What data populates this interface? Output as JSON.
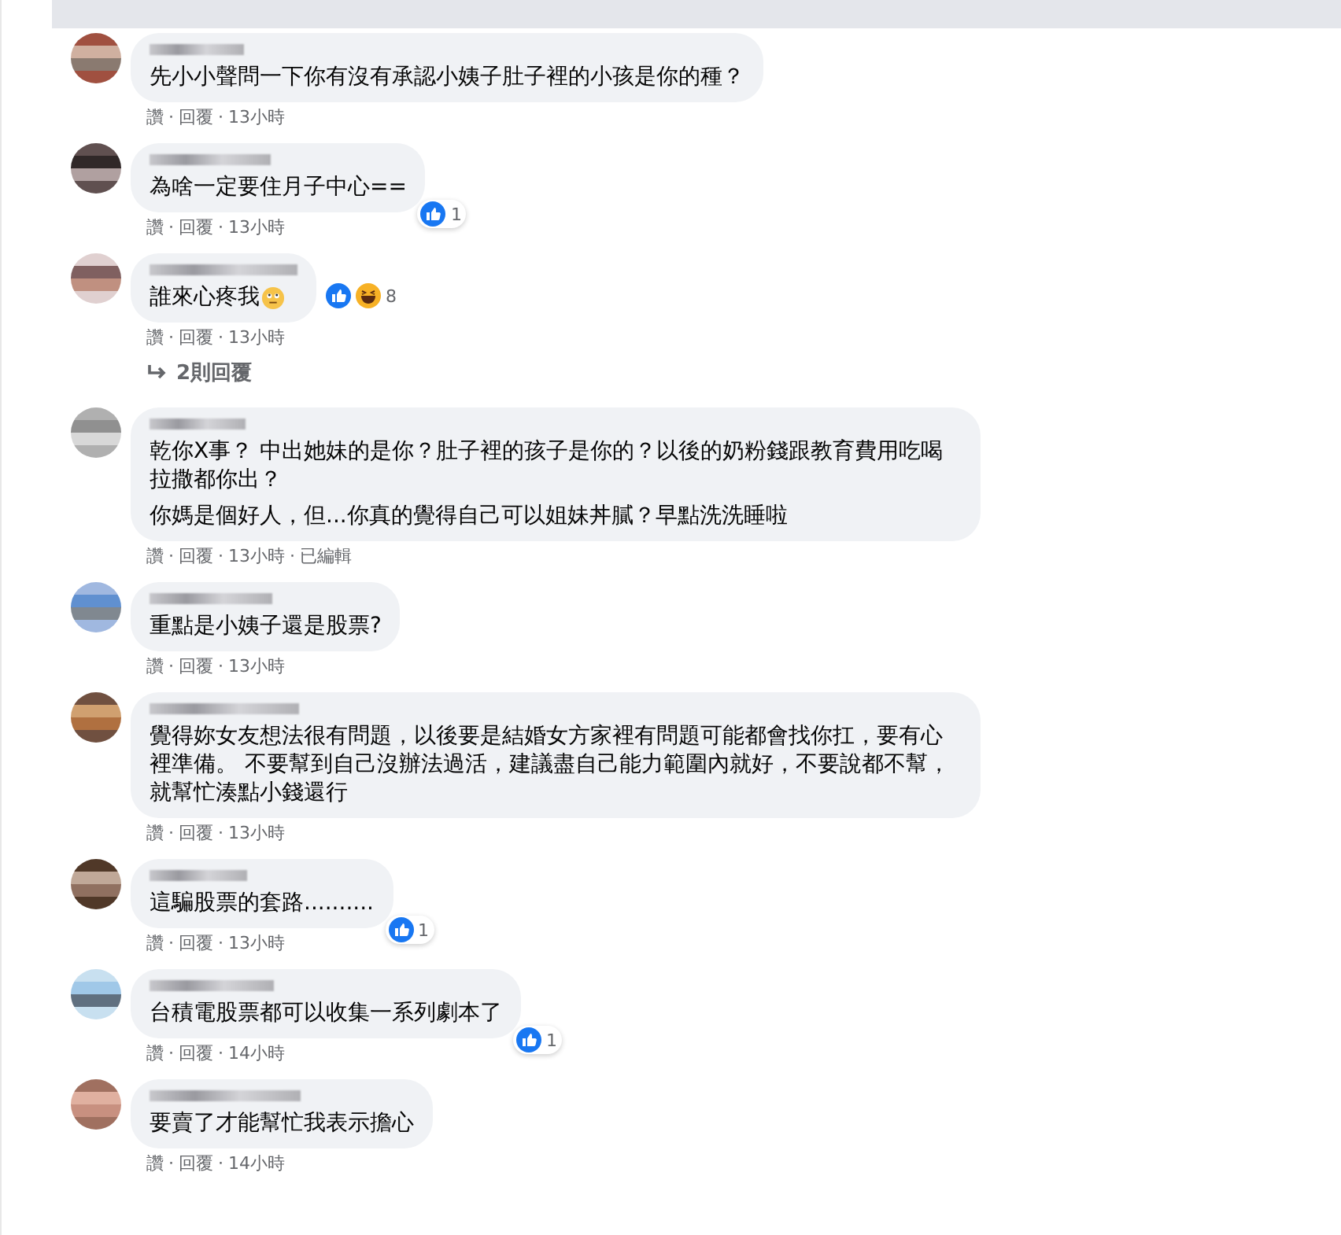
{
  "comments": [
    {
      "paragraphs": [
        "先小小聲問一下你有沒有承認小姨子肚子裡的小孩是你的種？"
      ],
      "actions": [
        {
          "text": "讚"
        },
        {
          "sep": "·",
          "text": "回覆"
        },
        {
          "sep": "·",
          "text": "13小時"
        }
      ]
    },
    {
      "paragraphs": [
        "為啥一定要住月子中心=="
      ],
      "reactions": {
        "kind": "corner",
        "icons": [
          {
            "kind": "like"
          }
        ],
        "count": "1"
      },
      "actions": [
        {
          "text": "讚"
        },
        {
          "sep": "·",
          "text": "回覆"
        },
        {
          "sep": "·",
          "text": "13小時"
        }
      ]
    },
    {
      "paragraphs": [
        "誰來心疼我"
      ],
      "emoji": {
        "kind": "rolling-eyes"
      },
      "reactions": {
        "kind": "side",
        "icons": [
          {
            "kind": "like"
          },
          {
            "kind": "haha"
          }
        ],
        "count": "8"
      },
      "actions": [
        {
          "text": "讚"
        },
        {
          "sep": "·",
          "text": "回覆"
        },
        {
          "sep": "·",
          "text": "13小時"
        }
      ],
      "replies": "2則回覆"
    },
    {
      "paragraphs": [
        "乾你X事？ 中出她妹的是你？肚子裡的孩子是你的？以後的奶粉錢跟教育費用吃喝拉撒都你出？",
        "你媽是個好人，但...你真的覺得自己可以姐妹丼膩？早點洗洗睡啦"
      ],
      "actions": [
        {
          "text": "讚"
        },
        {
          "sep": "·",
          "text": "回覆"
        },
        {
          "sep": "·",
          "text": "13小時"
        },
        {
          "sep": "·",
          "text": "已編輯"
        }
      ]
    },
    {
      "paragraphs": [
        "重點是小姨子還是股票?"
      ],
      "actions": [
        {
          "text": "讚"
        },
        {
          "sep": "·",
          "text": "回覆"
        },
        {
          "sep": "·",
          "text": "13小時"
        }
      ]
    },
    {
      "paragraphs": [
        "覺得妳女友想法很有問題，以後要是結婚女方家裡有問題可能都會找你扛，要有心裡準備。 不要幫到自己沒辦法過活，建議盡自己能力範圍內就好，不要說都不幫，就幫忙湊點小錢還行"
      ],
      "actions": [
        {
          "text": "讚"
        },
        {
          "sep": "·",
          "text": "回覆"
        },
        {
          "sep": "·",
          "text": "13小時"
        }
      ]
    },
    {
      "paragraphs": [
        "這騙股票的套路.........."
      ],
      "reactions": {
        "kind": "corner",
        "icons": [
          {
            "kind": "like"
          }
        ],
        "count": "1"
      },
      "actions": [
        {
          "text": "讚"
        },
        {
          "sep": "·",
          "text": "回覆"
        },
        {
          "sep": "·",
          "text": "13小時"
        }
      ]
    },
    {
      "paragraphs": [
        "台積電股票都可以收集一系列劇本了"
      ],
      "reactions": {
        "kind": "corner",
        "icons": [
          {
            "kind": "like"
          }
        ],
        "count": "1"
      },
      "actions": [
        {
          "text": "讚"
        },
        {
          "sep": "·",
          "text": "回覆"
        },
        {
          "sep": "·",
          "text": "14小時"
        }
      ]
    },
    {
      "paragraphs": [
        "要賣了才能幫忙我表示擔心"
      ],
      "actions": [
        {
          "text": "讚"
        },
        {
          "sep": "·",
          "text": "回覆"
        },
        {
          "sep": "·",
          "text": "14小時"
        }
      ]
    }
  ]
}
